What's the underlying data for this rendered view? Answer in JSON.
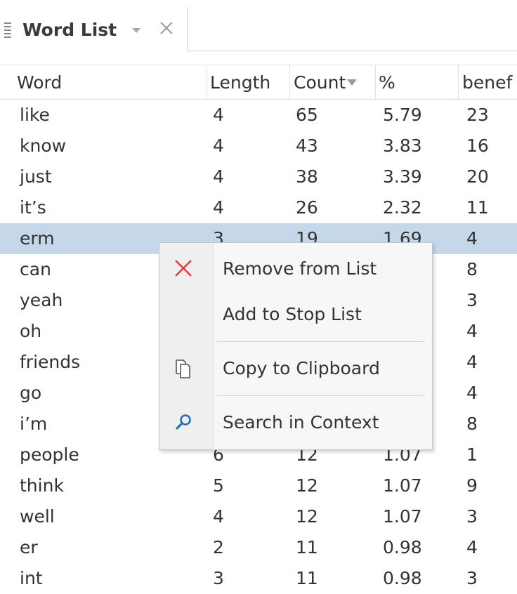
{
  "panel": {
    "title": "Word List",
    "icons": {
      "grip": "grip-icon",
      "dropdown": "chevron-down-icon",
      "close": "close-icon"
    }
  },
  "table": {
    "columns": [
      "Word",
      "Length",
      "Count",
      "%",
      "benef"
    ],
    "sorted_column": "Count",
    "sort_direction": "descending",
    "rows": [
      {
        "word": "like",
        "length": "4",
        "count": "65",
        "percent": "5.79",
        "benef": "23"
      },
      {
        "word": "know",
        "length": "4",
        "count": "43",
        "percent": "3.83",
        "benef": "16"
      },
      {
        "word": "just",
        "length": "4",
        "count": "38",
        "percent": "3.39",
        "benef": "20"
      },
      {
        "word": "it’s",
        "length": "4",
        "count": "26",
        "percent": "2.32",
        "benef": "11"
      },
      {
        "word": "erm",
        "length": "3",
        "count": "19",
        "percent": "1.69",
        "benef": "4"
      },
      {
        "word": "can",
        "length": "",
        "count": "",
        "percent": "",
        "benef": "8"
      },
      {
        "word": "yeah",
        "length": "",
        "count": "",
        "percent": "",
        "benef": "3"
      },
      {
        "word": "oh",
        "length": "",
        "count": "",
        "percent": "",
        "benef": "4"
      },
      {
        "word": "friends",
        "length": "",
        "count": "",
        "percent": "",
        "benef": "4"
      },
      {
        "word": "go",
        "length": "",
        "count": "",
        "percent": "",
        "benef": "4"
      },
      {
        "word": "i’m",
        "length": "",
        "count": "",
        "percent": "",
        "benef": "8"
      },
      {
        "word": "people",
        "length": "6",
        "count": "12",
        "percent": "1.07",
        "benef": "1"
      },
      {
        "word": "think",
        "length": "5",
        "count": "12",
        "percent": "1.07",
        "benef": "9"
      },
      {
        "word": "well",
        "length": "4",
        "count": "12",
        "percent": "1.07",
        "benef": "3"
      },
      {
        "word": "er",
        "length": "2",
        "count": "11",
        "percent": "0.98",
        "benef": "4"
      },
      {
        "word": "int",
        "length": "3",
        "count": "11",
        "percent": "0.98",
        "benef": "3"
      }
    ],
    "selected_row": 4,
    "selection_color": "#c7d7ea"
  },
  "context_menu": {
    "items": [
      {
        "label": "Remove from List",
        "icon": "remove-x-icon",
        "icon_color": "#e53935"
      },
      {
        "label": "Add to Stop List",
        "icon": ""
      },
      {
        "label": "Copy to Clipboard",
        "icon": "copy-icon",
        "icon_color": "#555555"
      },
      {
        "label": "Search in Context",
        "icon": "search-icon",
        "icon_color": "#2a6ebb"
      }
    ]
  }
}
